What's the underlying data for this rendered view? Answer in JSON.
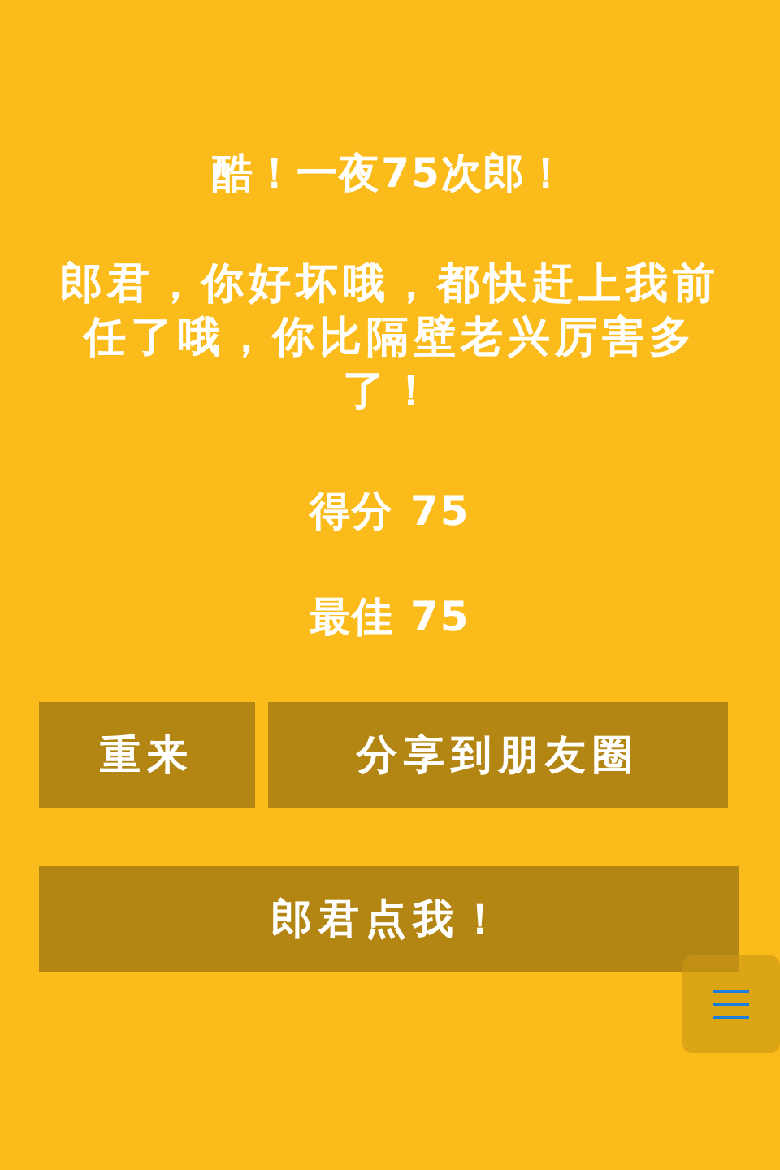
{
  "title": "酷！一夜75次郎！",
  "message": "郎君，你好坏哦，都快赶上我前任了哦，你比隔壁老兴厉害多了！",
  "stats": [
    {
      "label": "得分",
      "value": "75"
    },
    {
      "label": "最佳",
      "value": "75"
    }
  ],
  "buttons": [
    {
      "label": "重来",
      "kind": "retry"
    },
    {
      "label": "分享到朋友圈",
      "kind": "share"
    },
    {
      "label": "郎君点我！",
      "kind": "wide"
    }
  ],
  "menu_button": {
    "kind": "menu"
  }
}
